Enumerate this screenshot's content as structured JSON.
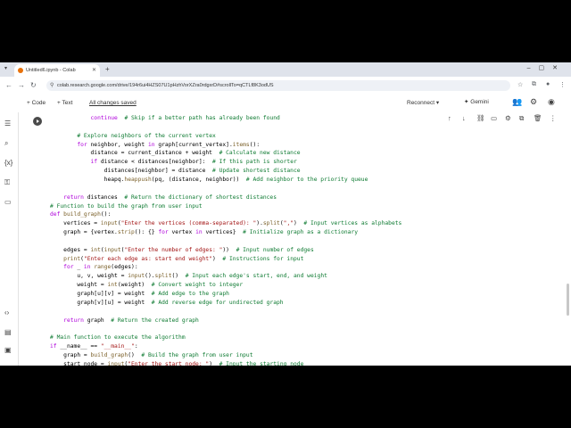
{
  "browser": {
    "tab_title": "Untitled6.ipynb - Colab",
    "url": "colab.research.google.com/drive/194r6ui4HZS07U1pHzhVorXZra0rdgxrD#scrollTo=qCTLf8K3odUS"
  },
  "toolbar": {
    "code_label": "+ Code",
    "text_label": "+ Text",
    "saved_label": "All changes saved",
    "reconnect_label": "Reconnect",
    "gemini_label": "Gemini"
  },
  "code_lines": [
    "            continue  # Skip if a better path has already been found",
    "",
    "        # Explore neighbors of the current vertex",
    "        for neighbor, weight in graph[current_vertex].items():",
    "            distance = current_distance + weight  # Calculate new distance",
    "            if distance < distances[neighbor]:  # If this path is shorter",
    "                distances[neighbor] = distance  # Update shortest distance",
    "                heapq.heappush(pq, (distance, neighbor))  # Add neighbor to the priority queue",
    "",
    "    return distances  # Return the dictionary of shortest distances",
    "# Function to build the graph from user input",
    "def build_graph():",
    "    vertices = input(\"Enter the vertices (comma-separated): \").split(\",\")  # Input vertices as alphabets",
    "    graph = {vertex.strip(): {} for vertex in vertices}  # Initialize graph as a dictionary",
    "",
    "    edges = int(input(\"Enter the number of edges: \"))  # Input number of edges",
    "    print(\"Enter each edge as: start end weight\")  # Instructions for input",
    "    for _ in range(edges):",
    "        u, v, weight = input().split()  # Input each edge's start, end, and weight",
    "        weight = int(weight)  # Convert weight to integer",
    "        graph[u][v] = weight  # Add edge to the graph",
    "        graph[v][u] = weight  # Add reverse edge for undirected graph",
    "",
    "    return graph  # Return the created graph",
    "",
    "# Main function to execute the algorithm",
    "if __name__ == \"__main__\":",
    "    graph = build_graph()  # Build the graph from user input",
    "    start_node = input(\"Enter the start node: \")  # Input the starting node"
  ]
}
